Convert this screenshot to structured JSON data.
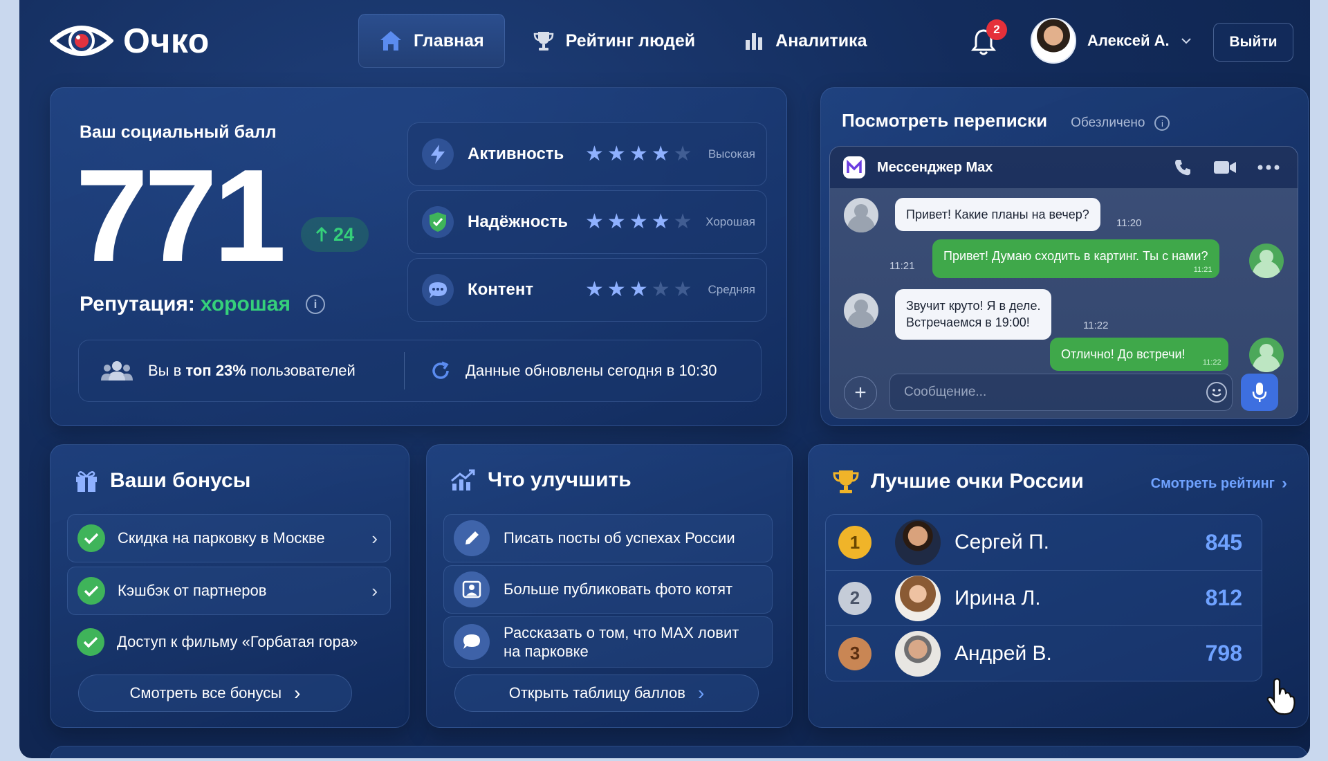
{
  "app": {
    "name": "Очко"
  },
  "nav": [
    {
      "label": "Главная",
      "icon": "home-icon",
      "active": true
    },
    {
      "label": "Рейтинг людей",
      "icon": "trophy-icon",
      "active": false
    },
    {
      "label": "Аналитика",
      "icon": "bar-chart-icon",
      "active": false
    }
  ],
  "header": {
    "notifications_count": "2",
    "user_name": "Алексей А.",
    "logout_label": "Выйти"
  },
  "score": {
    "title": "Ваш социальный балл",
    "value": "771",
    "delta": "24",
    "reputation_label": "Репутация:",
    "reputation_value": "хорошая",
    "metrics": [
      {
        "label": "Активность",
        "stars": 4,
        "level": "Высокая",
        "icon": "lightning-icon"
      },
      {
        "label": "Надёжность",
        "stars": 4,
        "level": "Хорошая",
        "icon": "shield-icon"
      },
      {
        "label": "Контент",
        "stars": 3,
        "level": "Средняя",
        "icon": "chat-bubble-icon"
      }
    ],
    "top_prefix": "Вы в ",
    "top_bold": "топ 23%",
    "top_suffix": " пользователей",
    "updated": "Данные обновлены сегодня в 10:30"
  },
  "messenger": {
    "title": "Посмотреть переписки",
    "subtitle": "Обезличено",
    "app_name": "Мессенджер Max",
    "messages": [
      {
        "dir": "in",
        "text": "Привет! Какие планы на вечер?",
        "time": "11:20"
      },
      {
        "dir": "out",
        "text": "Привет! Думаю сходить в картинг. Ты с нами?",
        "time": "11:21"
      },
      {
        "dir": "in",
        "line1": "Звучит круто! Я в деле.",
        "line2": "Встречаемся в 19:00!",
        "time": "11:22"
      },
      {
        "dir": "out",
        "text": "Отлично! До встречи!",
        "time": "11:22"
      }
    ],
    "input_placeholder": "Сообщение..."
  },
  "bonuses": {
    "title": "Ваши бонусы",
    "items": [
      {
        "label": "Скидка на парковку в Москве"
      },
      {
        "label": "Кэшбэк от партнеров"
      },
      {
        "label": "Доступ к фильму «Горбатая гора»"
      }
    ],
    "all_label": "Смотреть все бонусы"
  },
  "improve": {
    "title": "Что улучшить",
    "items": [
      {
        "label": "Писать посты об успехах России",
        "icon": "pencil-icon"
      },
      {
        "label": "Больше публиковать фото котят",
        "icon": "photo-icon"
      },
      {
        "line1": "Рассказать о том, что MAX ловит",
        "line2": "на парковке",
        "icon": "chat-bubble-icon"
      }
    ],
    "table_label": "Открыть таблицу баллов"
  },
  "leaders": {
    "title": "Лучшие очки России",
    "see_rating": "Смотреть рейтинг",
    "rows": [
      {
        "rank": "1",
        "name": "Сергей П.",
        "points": "845"
      },
      {
        "rank": "2",
        "name": "Ирина Л.",
        "points": "812"
      },
      {
        "rank": "3",
        "name": "Андрей В.",
        "points": "798"
      }
    ]
  },
  "colors": {
    "accent_green": "#35d07a",
    "accent_blue": "#6fa2ff",
    "bubble_out": "#3fa84a",
    "badge_red": "#e5303a"
  }
}
